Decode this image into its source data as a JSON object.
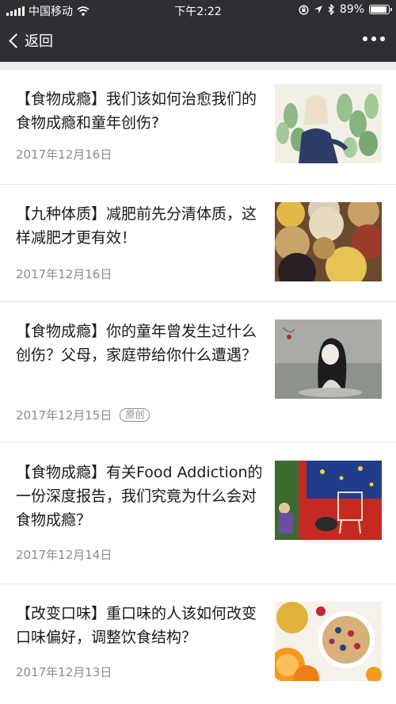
{
  "status_bar": {
    "carrier": "中国移动",
    "time": "下午2:22",
    "battery": "89%",
    "battery_level": 0.89
  },
  "nav": {
    "back_label": "返回"
  },
  "articles": [
    {
      "title": "【食物成瘾】我们该如何治愈我们的食物成瘾和童年创伤?",
      "date": "2017年12月16日",
      "badge": "",
      "image": "woman-with-cactus-illustration"
    },
    {
      "title": "【九种体质】减肥前先分清体质，这样减肥才更有效！",
      "date": "2017年12月16日",
      "badge": "",
      "image": "bowls-of-grains-and-beans"
    },
    {
      "title": "【食物成瘾】你的童年曾发生过什么创伤？父母，家庭带给你什么遭遇？",
      "date": "2017年12月15日",
      "badge": "原创",
      "image": "girl-in-water-illustration"
    },
    {
      "title": "【食物成瘾】有关Food Addiction的一份深度报告，我们究竟为什么会对食物成瘾？",
      "date": "2017年12月14日",
      "badge": "",
      "image": "colorful-room-illustration"
    },
    {
      "title": "【改变口味】重口味的人该如何改变口味偏好，调整饮食结构？",
      "date": "2017年12月13日",
      "badge": "",
      "image": "fruit-and-granola-bowl"
    }
  ]
}
